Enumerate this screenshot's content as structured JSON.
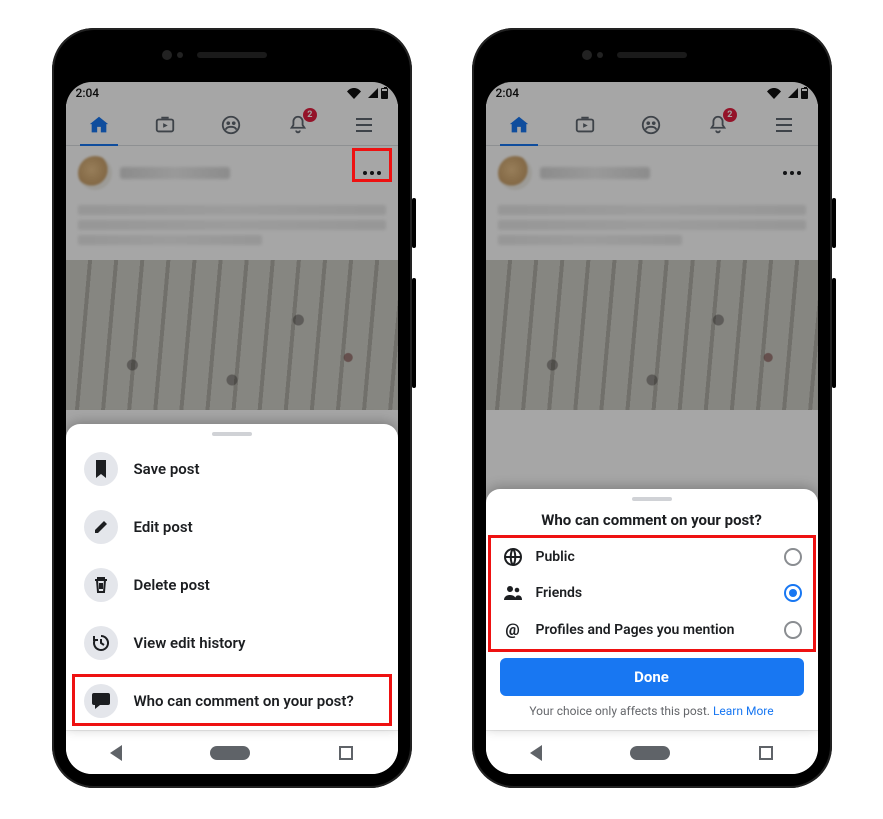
{
  "status": {
    "time": "2:04"
  },
  "nav": {
    "badge": "2"
  },
  "sheet1": {
    "items": [
      {
        "label": "Save post"
      },
      {
        "label": "Edit post"
      },
      {
        "label": "Delete post"
      },
      {
        "label": "View edit history"
      },
      {
        "label": "Who can comment on your post?"
      }
    ]
  },
  "sheet2": {
    "title": "Who can comment on your post?",
    "options": [
      {
        "label": "Public",
        "selected": false
      },
      {
        "label": "Friends",
        "selected": true
      },
      {
        "label": "Profiles and Pages you mention",
        "selected": false
      }
    ],
    "done": "Done",
    "footnote": "Your choice only affects this post.",
    "learn_more": "Learn More"
  }
}
